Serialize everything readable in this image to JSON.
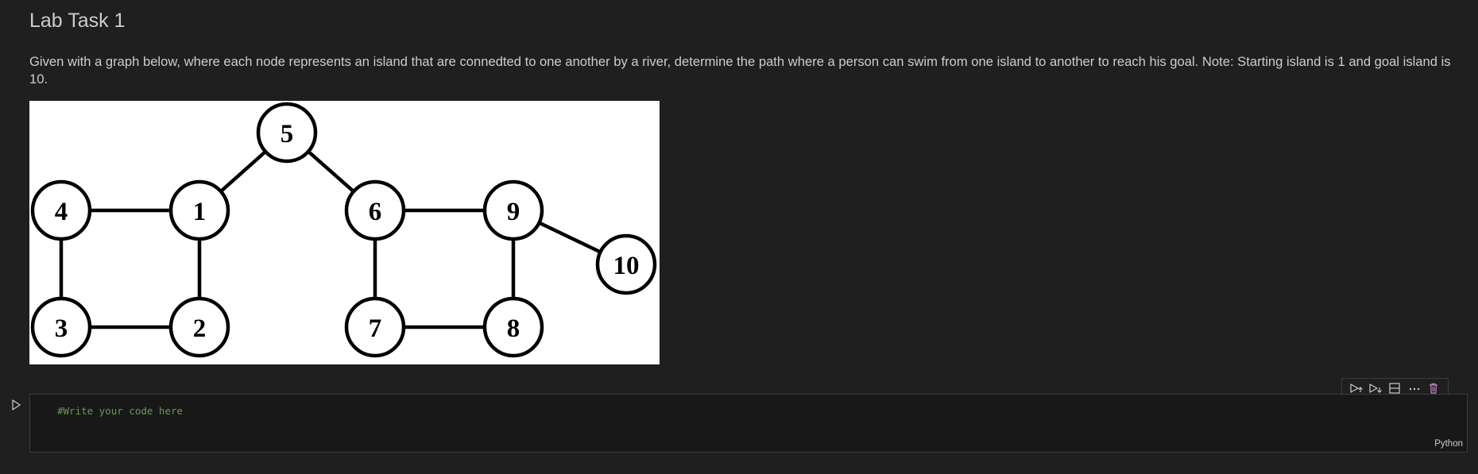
{
  "markdown_cell": {
    "title": "Lab Task 1",
    "paragraph": "Given with a graph below, where each node represents an island that are connedted to one another by a river, determine the path where a person can swim from one island to another to reach his goal. Note: Starting island is 1 and goal island is 10."
  },
  "graph": {
    "nodes": [
      "1",
      "2",
      "3",
      "4",
      "5",
      "6",
      "7",
      "8",
      "9",
      "10"
    ],
    "edges": [
      [
        "4",
        "1"
      ],
      [
        "1",
        "5"
      ],
      [
        "5",
        "6"
      ],
      [
        "6",
        "9"
      ],
      [
        "9",
        "10"
      ],
      [
        "4",
        "3"
      ],
      [
        "3",
        "2"
      ],
      [
        "1",
        "2"
      ],
      [
        "6",
        "7"
      ],
      [
        "7",
        "8"
      ],
      [
        "9",
        "8"
      ]
    ]
  },
  "code_cell": {
    "code": "#Write your code here",
    "language": "Python"
  },
  "toolbar": {
    "icons": [
      "execute-above-icon",
      "execute-below-icon",
      "split-cell-icon",
      "more-actions-icon",
      "delete-icon"
    ]
  },
  "colors": {
    "background": "#1f1f1f",
    "code_background": "#181818",
    "comment": "#6a9955",
    "text": "#cccccc",
    "delete_accent": "#c586c0"
  }
}
